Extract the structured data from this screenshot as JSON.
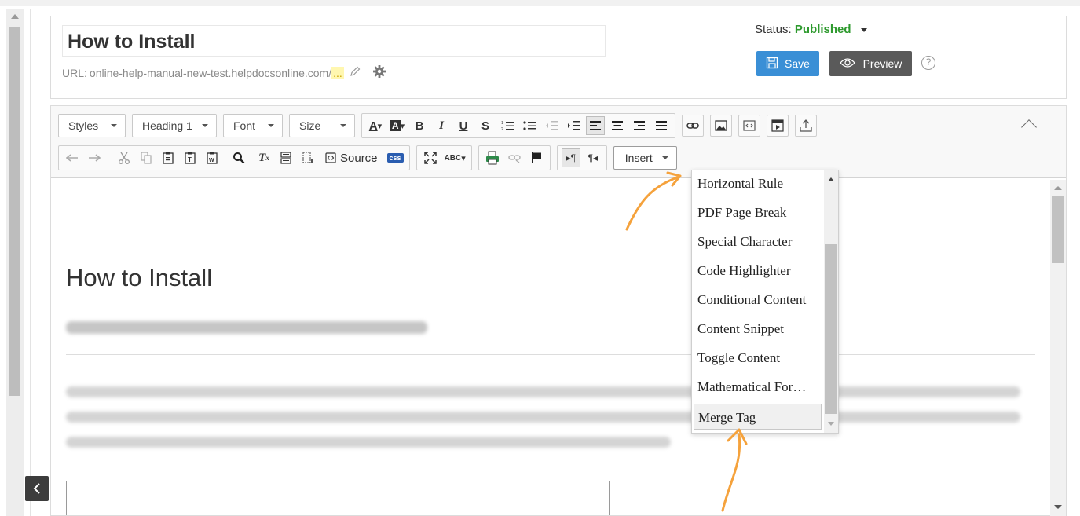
{
  "page": {
    "title": "How to Install",
    "url_label": "URL:",
    "url_value": "online-help-manual-new-test.helpdocsonline.com/",
    "url_ellipsis": "...",
    "status_label": "Status:",
    "status_value": "Published",
    "save_label": "Save",
    "preview_label": "Preview",
    "help_symbol": "?"
  },
  "toolbar": {
    "styles_label": "Styles",
    "heading_label": "Heading 1",
    "font_label": "Font",
    "size_label": "Size",
    "source_label": "Source",
    "css_badge": "css",
    "insert_label": "Insert"
  },
  "content": {
    "heading": "How to Install"
  },
  "dropdown": {
    "items": [
      "Horizontal Rule",
      "PDF Page Break",
      "Special Character",
      "Code Highlighter",
      "Conditional Content",
      "Content Snippet",
      "Toggle Content",
      "Mathematical For…",
      "Merge Tag"
    ],
    "highlighted": "Merge Tag"
  },
  "colors": {
    "published_green": "#2e9a2e",
    "save_blue": "#3a8fd6",
    "preview_gray": "#5a5a5a",
    "annotation_orange": "#f5a23c"
  }
}
